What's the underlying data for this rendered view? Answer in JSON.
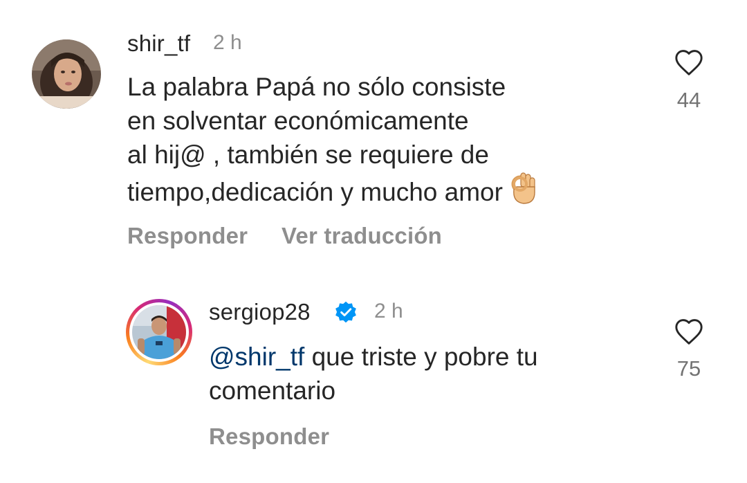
{
  "comments": [
    {
      "username": "shir_tf",
      "time": "2 h",
      "text_lines": [
        "La palabra Papá no sólo consiste",
        "en solventar económicamente",
        "al hij@ , también se requiere de",
        "tiempo,dedicación y mucho amor"
      ],
      "emoji": "ok-hand-emoji",
      "likes": "44",
      "actions": [
        "Responder",
        "Ver traducción"
      ]
    }
  ],
  "reply": {
    "username": "sergiop28",
    "verified": true,
    "time": "2 h",
    "mention": "@shir_tf",
    "text_line1_rest": " que triste y pobre tu",
    "text_line2": "comentario",
    "likes": "75",
    "actions": [
      "Responder"
    ]
  },
  "icons": {
    "heart": "heart-outline-icon",
    "verified": "verified-badge-icon"
  },
  "colors": {
    "text": "#262626",
    "muted": "#8e8e8e",
    "mention": "#00376b",
    "verified": "#0095f6"
  }
}
